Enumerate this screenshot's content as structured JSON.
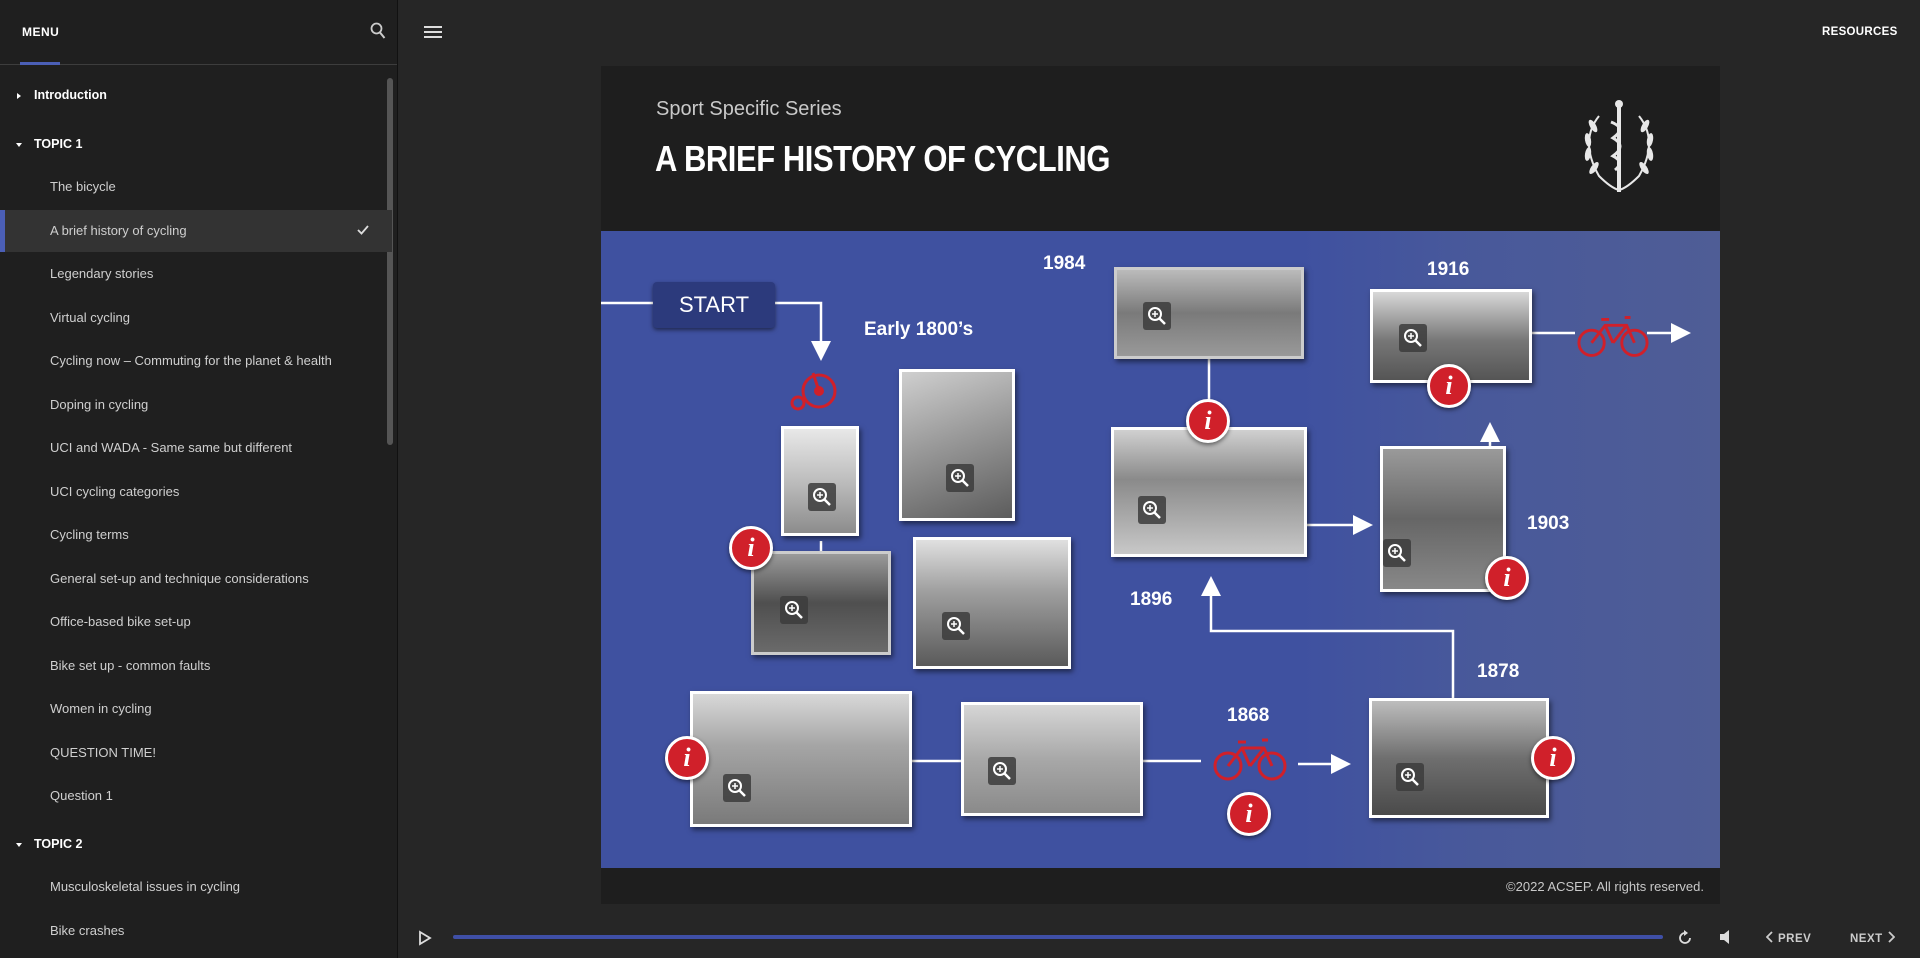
{
  "sidebar": {
    "menu_label": "MENU",
    "introduction": "Introduction",
    "topic1": "TOPIC 1",
    "topic1_lessons": [
      "The bicycle",
      "A brief history of cycling",
      "Legendary stories",
      "Virtual cycling",
      "Cycling now – Commuting for the planet & health",
      "Doping in cycling",
      "UCI and WADA - Same same but different",
      "UCI cycling categories",
      "Cycling terms",
      "General set-up and technique considerations",
      "Office-based bike set-up",
      "Bike set up - common faults",
      "Women in cycling",
      "QUESTION TIME!",
      "Question 1"
    ],
    "active_lesson_index": 1,
    "topic2": "TOPIC 2",
    "topic2_lessons": [
      "Musculoskeletal issues in cycling",
      "Bike crashes"
    ]
  },
  "topbar": {
    "resources_label": "RESOURCES"
  },
  "slide": {
    "series": "Sport Specific Series",
    "title": "A BRIEF HISTORY OF CYCLING",
    "copyright": "©2022 ACSEP. All rights reserved.",
    "start_label": "START",
    "years": {
      "early": "Early 1800’s",
      "y1868": "1868",
      "y1878": "1878",
      "y1896": "1896",
      "y1903": "1903",
      "y1916": "1916",
      "y1984": "1984"
    },
    "info_glyph": "i"
  },
  "player": {
    "prev_label": "PREV",
    "next_label": "NEXT"
  },
  "colors": {
    "accent": "#4b5fb6",
    "slide_blue": "#3f51a0",
    "info_red": "#d0202a"
  }
}
